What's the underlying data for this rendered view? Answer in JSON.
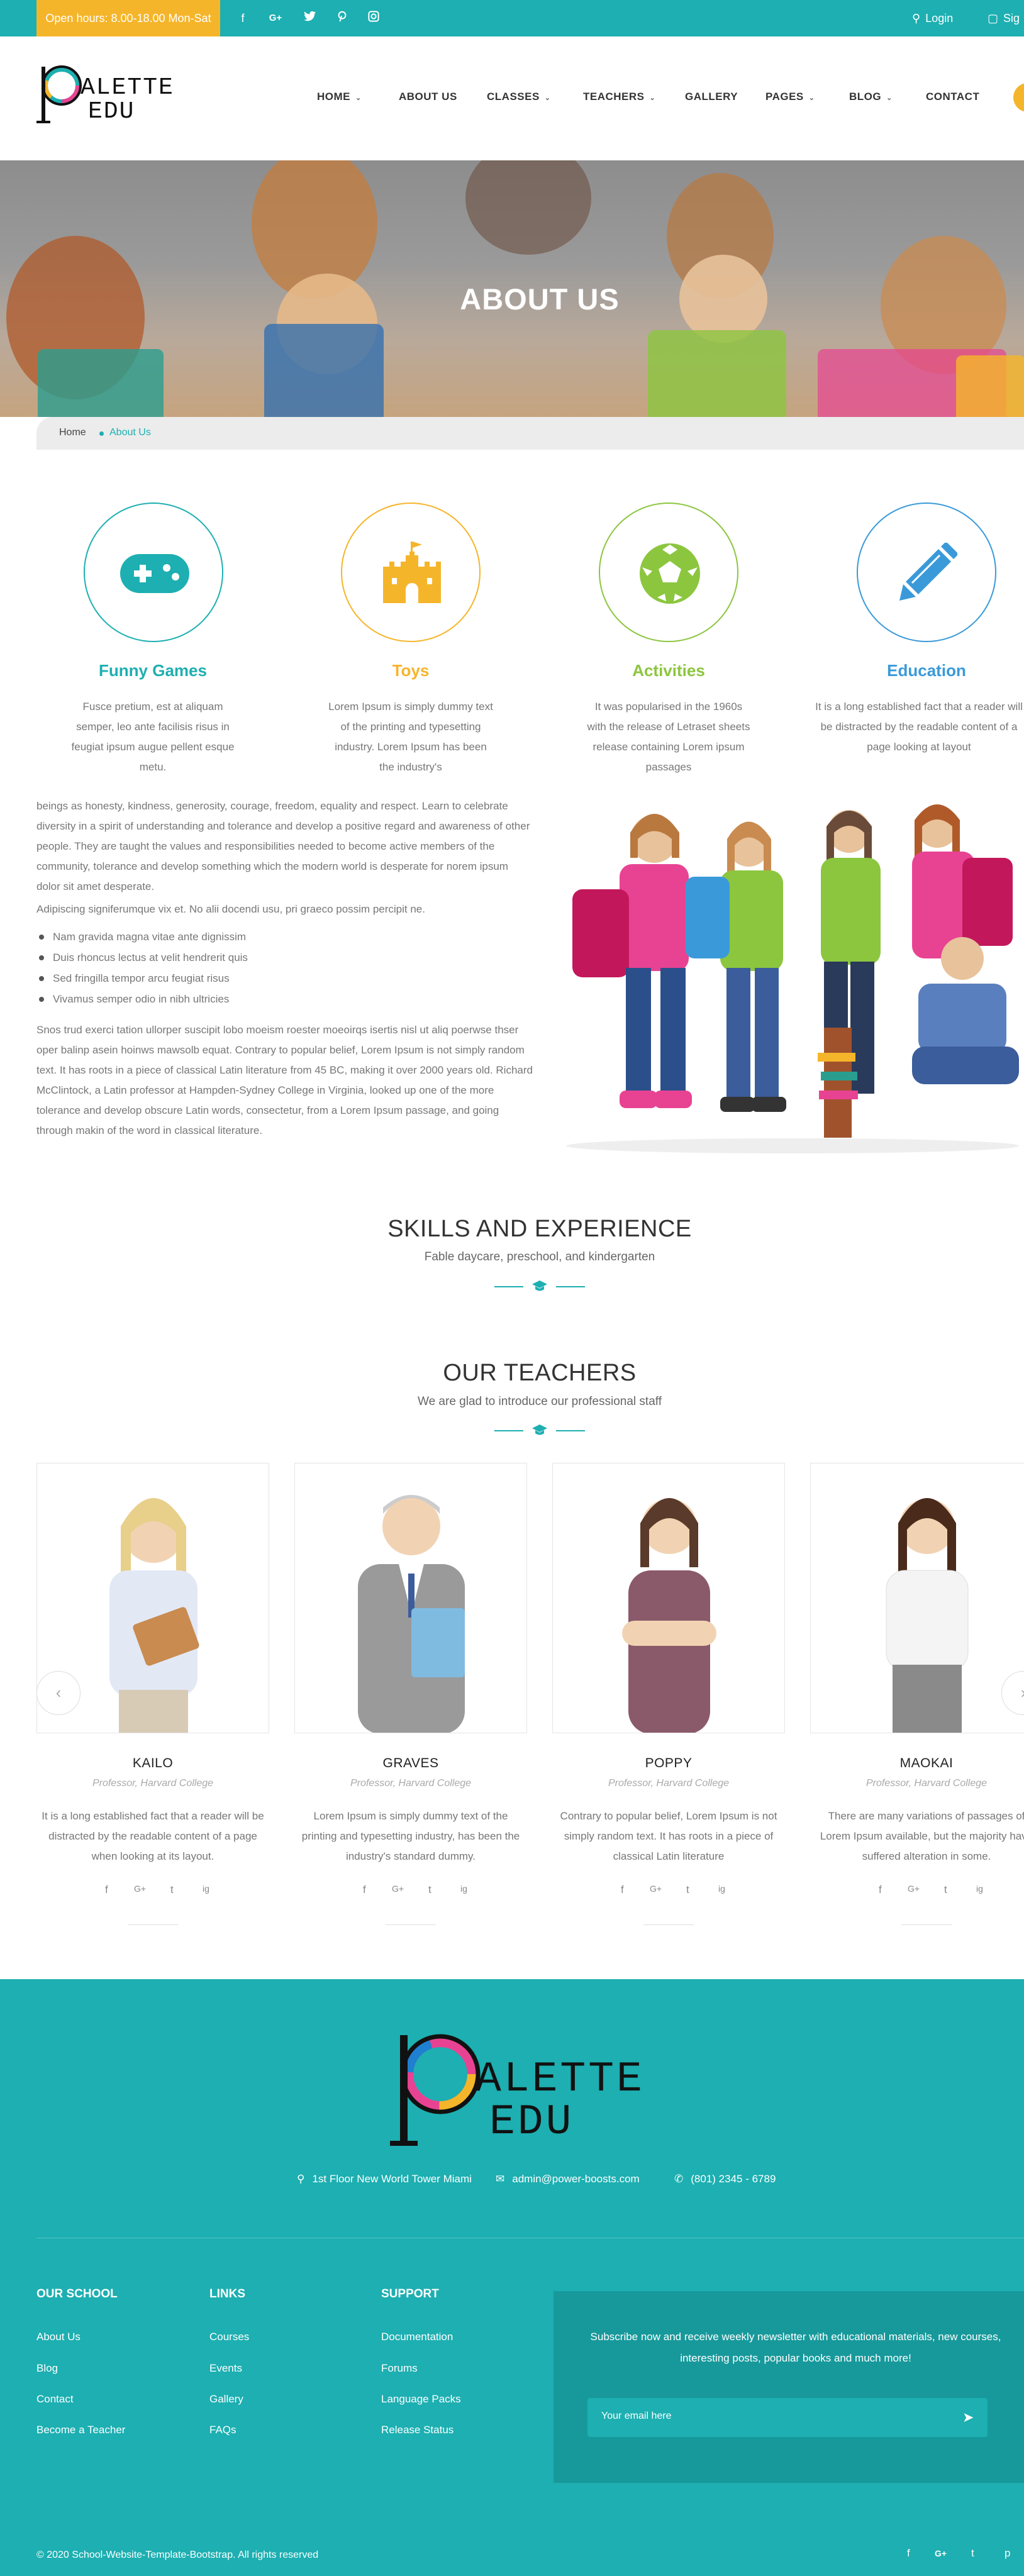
{
  "topbar": {
    "hours": "Open hours: 8.00-18.00 Mon-Sat",
    "social": [
      "f",
      "G+",
      "t",
      "p",
      "ig"
    ],
    "login": "Login",
    "signup": "Sig"
  },
  "logo": {
    "line1": "ALETTE",
    "line2": "EDU"
  },
  "nav": [
    "HOME",
    "ABOUT US",
    "CLASSES",
    "TEACHERS",
    "GALLERY",
    "PAGES",
    "BLOG",
    "CONTACT"
  ],
  "hero": {
    "title": "ABOUT US"
  },
  "breadcrumb": {
    "home": "Home",
    "current": "About Us"
  },
  "features": [
    {
      "title": "Funny Games",
      "text": "Fusce pretium, est at aliquam semper, leo ante facilisis risus in feugiat ipsum augue pellent esque metu.",
      "color": "#1dafb1",
      "icon": "gamepad-icon"
    },
    {
      "title": "Toys",
      "text": "Lorem Ipsum is simply dummy text of the printing and typesetting industry. Lorem Ipsum has been the industry's",
      "color": "#f5b52a",
      "icon": "castle-icon"
    },
    {
      "title": "Activities",
      "text": "It was popularised in the 1960s with the release of Letraset sheets release containing Lorem ipsum passages",
      "color": "#8cc63f",
      "icon": "soccer-ball-icon"
    },
    {
      "title": "Education",
      "text": "It is a long established fact that a reader will be distracted by the readable content of a page looking at layout",
      "color": "#3a9ad9",
      "icon": "pencil-icon"
    }
  ],
  "about": {
    "paragraph1": "beings as honesty, kindness, generosity, courage, freedom, equality and respect. Learn to celebrate diversity in a spirit of understanding and tolerance and develop a positive regard and awareness of other people. They are taught the values and responsibilities needed to become active members of the community, tolerance and develop something which the modern world is desperate for norem ipsum dolor sit amet desperate.",
    "paragraph2": "Adipiscing signiferumque vix et. No alii docendi usu, pri graeco possim percipit ne.",
    "bullets": [
      "Nam gravida magna vitae ante dignissim",
      "Duis rhoncus lectus at velit hendrerit quis",
      "Sed fringilla tempor arcu feugiat risus",
      "Vivamus semper odio in nibh ultricies"
    ],
    "paragraph3": "Snos trud exerci tation ullorper suscipit lobo moeism roester moeoirqs isertis nisl ut aliq poerwse thser oper balinp asein hoinws mawsolb equat. Contrary to popular belief, Lorem Ipsum is not simply random text. It has roots in a piece of classical Latin literature from 45 BC, making it over 2000 years old. Richard McClintock, a Latin professor at Hampden-Sydney College in Virginia, looked up one of the more tolerance and develop obscure Latin words, consectetur, from a Lorem Ipsum passage, and going through makin of the word in classical literature."
  },
  "skills": {
    "title": "SKILLS AND EXPERIENCE",
    "subtitle": "Fable daycare, preschool, and kindergarten"
  },
  "teachers_section": {
    "title": "OUR TEACHERS",
    "subtitle": "We are glad to introduce our professional staff"
  },
  "teachers": [
    {
      "name": "KAILO",
      "role": "Professor, Harvard College",
      "text": "It is a long established fact that a reader will be distracted by the readable content of a page when looking at its layout."
    },
    {
      "name": "GRAVES",
      "role": "Professor, Harvard College",
      "text": "Lorem Ipsum is simply dummy text of the printing and typesetting industry, has been the industry's standard dummy."
    },
    {
      "name": "POPPY",
      "role": "Professor, Harvard College",
      "text": "Contrary to popular belief, Lorem Ipsum is not simply random text. It has roots in a piece of classical Latin literature"
    },
    {
      "name": "MAOKAI",
      "role": "Professor, Harvard College",
      "text": "There are many variations of passages of Lorem Ipsum available, but the majority have suffered alteration in some."
    }
  ],
  "teacher_social": [
    "f",
    "G+",
    "t",
    "ig"
  ],
  "footer": {
    "logo": {
      "line1": "ALETTE",
      "line2": "EDU"
    },
    "address": "1st Floor New World Tower Miami",
    "email": "admin@power-boosts.com",
    "phone": "(801) 2345 - 6789",
    "columns": [
      {
        "title": "OUR SCHOOL",
        "links": [
          "About Us",
          "Blog",
          "Contact",
          "Become a Teacher"
        ]
      },
      {
        "title": "LINKS",
        "links": [
          "Courses",
          "Events",
          "Gallery",
          "FAQs"
        ]
      },
      {
        "title": "SUPPORT",
        "links": [
          "Documentation",
          "Forums",
          "Language Packs",
          "Release Status"
        ]
      }
    ],
    "newsletter_text": "Subscribe now and receive weekly newsletter with educational materials, new courses, interesting posts, popular books and much more!",
    "email_placeholder": "Your email here",
    "copyright": "© 2020 School-Website-Template-Bootstrap. All rights reserved",
    "social": [
      "f",
      "G+",
      "t",
      "p"
    ]
  },
  "colors": {
    "teal": "#1dafb1",
    "yellow": "#f5b52a",
    "green": "#8cc63f",
    "blue": "#3a9ad9"
  }
}
